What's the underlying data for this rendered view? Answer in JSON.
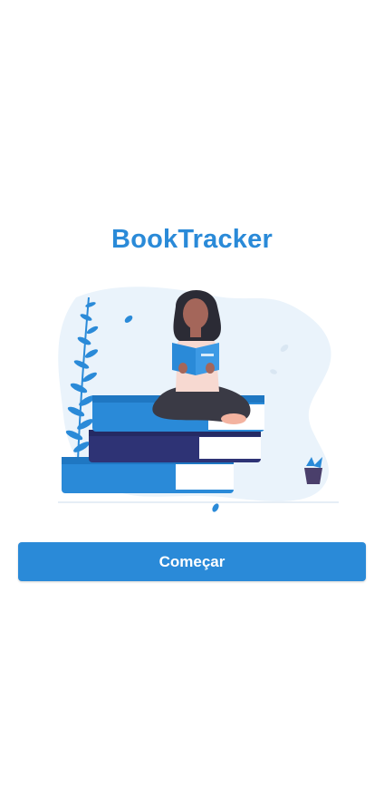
{
  "app": {
    "title": "BookTracker"
  },
  "welcome": {
    "start_button_label": "Começar"
  },
  "colors": {
    "brand": "#2a8ad8",
    "background": "#ffffff"
  },
  "illustration": {
    "icon_name": "woman-reading-on-books-illustration"
  }
}
